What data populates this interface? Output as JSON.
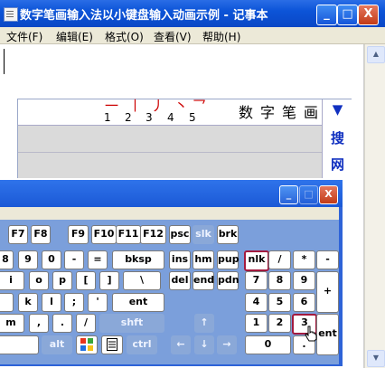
{
  "notepad": {
    "title": "数字笔画输入法以小键盘输入动画示例 - 记事本",
    "controls": {
      "minimize": "_",
      "maximize": "□",
      "close": "X"
    },
    "menu": [
      "文件(F)",
      "编辑(E)",
      "格式(O)",
      "查看(V)",
      "帮助(H)"
    ]
  },
  "ime": {
    "strokes": [
      {
        "glyph": "一",
        "num": "1"
      },
      {
        "glyph": "丨",
        "num": "2"
      },
      {
        "glyph": "丿",
        "num": "3"
      },
      {
        "glyph": "丶",
        "num": "4"
      },
      {
        "glyph": "乛",
        "num": "5"
      }
    ],
    "title_chars": [
      "数",
      "字",
      "笔",
      "画"
    ],
    "side": {
      "arrow": "▼",
      "line1": "搜",
      "line2": "网"
    }
  },
  "osk": {
    "title_controls": {
      "minimize": "_",
      "maximize": "□",
      "close": "X"
    },
    "keys": {
      "f7": "F7",
      "f8": "F8",
      "f9": "F9",
      "f10": "F10",
      "f11": "F11",
      "f12": "F12",
      "psc": "psc",
      "slk": "slk",
      "brk": "brk",
      "k8": "8",
      "k9": "9",
      "k0": "0",
      "minus": "-",
      "equals": "=",
      "bksp": "bksp",
      "ins": "ins",
      "hm": "hm",
      "pup": "pup",
      "nlk": "nlk",
      "slash": "/",
      "star": "*",
      "nminus": "-",
      "i": "i",
      "o": "o",
      "p": "p",
      "lbr": "[",
      "rbr": "]",
      "bslash": "\\",
      "del": "del",
      "end": "end",
      "pdn": "pdn",
      "n7": "7",
      "n8": "8",
      "n9": "9",
      "nplus": "+",
      "k": "k",
      "l": "l",
      "semi": ";",
      "quote": "'",
      "ent": "ent",
      "n4": "4",
      "n5": "5",
      "n6": "6",
      "m": "m",
      "comma": ",",
      "period": ".",
      "fslash": "/",
      "shft": "shft",
      "up": "↑",
      "n1": "1",
      "n2": "2",
      "n3": "3",
      "nent": "ent",
      "alt": "alt",
      "ctrl": "ctrl",
      "left": "←",
      "down": "↓",
      "right": "→",
      "n0": "0",
      "ndot": "."
    }
  },
  "colors": {
    "title_blue": "#0c54d8",
    "stroke_red": "#cc0000",
    "selected_border": "#a31a3e"
  }
}
